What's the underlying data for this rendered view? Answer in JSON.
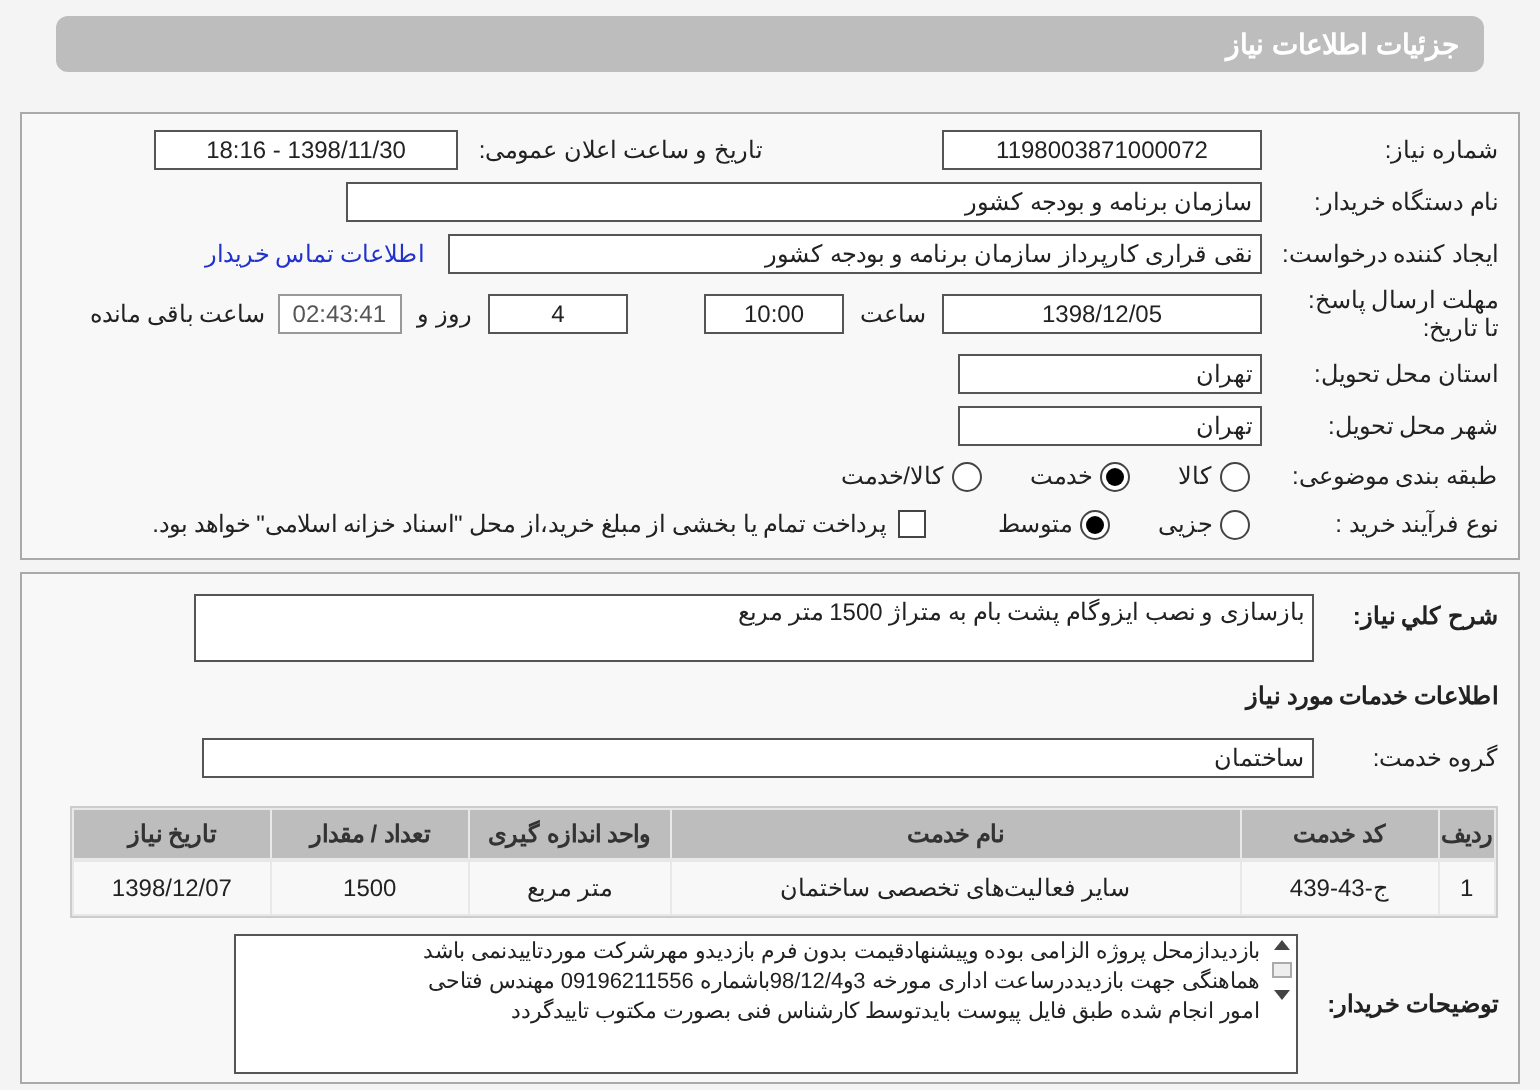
{
  "header": {
    "title": "جزئیات اطلاعات نیاز"
  },
  "need_number": {
    "label": "شماره نیاز:",
    "value": "1198003871000072"
  },
  "announce_date": {
    "label": "تاریخ و ساعت اعلان عمومی:",
    "value": "1398/11/30 - 18:16"
  },
  "buyer_org": {
    "label": "نام دستگاه خریدار:",
    "value": "سازمان برنامه و بودجه کشور"
  },
  "requester": {
    "label": "ایجاد کننده درخواست:",
    "value": "نقی قراری کارپرداز سازمان برنامه و بودجه کشور",
    "link": "اطلاعات تماس خریدار"
  },
  "deadline": {
    "label_1": "مهلت ارسال پاسخ:",
    "label_2": "تا تاریخ:",
    "date": "1398/12/05",
    "time_label": "ساعت",
    "time": "10:00",
    "days": "4",
    "days_label": "روز و",
    "remaining": "02:43:41",
    "remaining_label": "ساعت باقی مانده"
  },
  "province": {
    "label": "استان محل تحویل:",
    "value": "تهران"
  },
  "city": {
    "label": "شهر محل تحویل:",
    "value": "تهران"
  },
  "category": {
    "label": "طبقه بندی موضوعی:",
    "options": [
      {
        "label": "کالا",
        "selected": false
      },
      {
        "label": "خدمت",
        "selected": true
      },
      {
        "label": "کالا/خدمت",
        "selected": false
      }
    ]
  },
  "process": {
    "label": "نوع فرآیند خرید :",
    "options": [
      {
        "label": "جزیی",
        "selected": false
      },
      {
        "label": "متوسط",
        "selected": true
      }
    ],
    "treasury": {
      "label": "پرداخت تمام یا بخشی از مبلغ خرید،از محل \"اسناد خزانه اسلامی\" خواهد بود.",
      "checked": false
    }
  },
  "description": {
    "label": "شرح کلي نیاز:",
    "value": "بازسازی و نصب ایزوگام پشت بام به متراژ 1500 متر مربع"
  },
  "services_heading": "اطلاعات خدمات مورد نیاز",
  "service_group": {
    "label": "گروه خدمت:",
    "value": "ساختمان"
  },
  "table": {
    "columns": [
      "ردیف",
      "کد خدمت",
      "نام خدمت",
      "واحد اندازه گیری",
      "تعداد / مقدار",
      "تاریخ نیاز"
    ],
    "rows": [
      [
        "1",
        "ج-43-439",
        "سایر فعالیت‌های تخصصی ساختمان",
        "متر مربع",
        "1500",
        "1398/12/07"
      ]
    ]
  },
  "buyer_notes": {
    "label": "توضیحات خریدار:",
    "lines": [
      "بازدیدازمحل پروژه الزامی بوده وپیشنهادقیمت بدون فرم بازدیدو مهرشرکت موردتاییدنمی باشد",
      "هماهنگی جهت بازدیددرساعت اداری مورخه 3و98/12/4باشماره 09196211556 مهندس فتاحی",
      "امور انجام شده طبق فایل پیوست بایدتوسط کارشناس فنی بصورت مکتوب تاییدگردد"
    ]
  }
}
